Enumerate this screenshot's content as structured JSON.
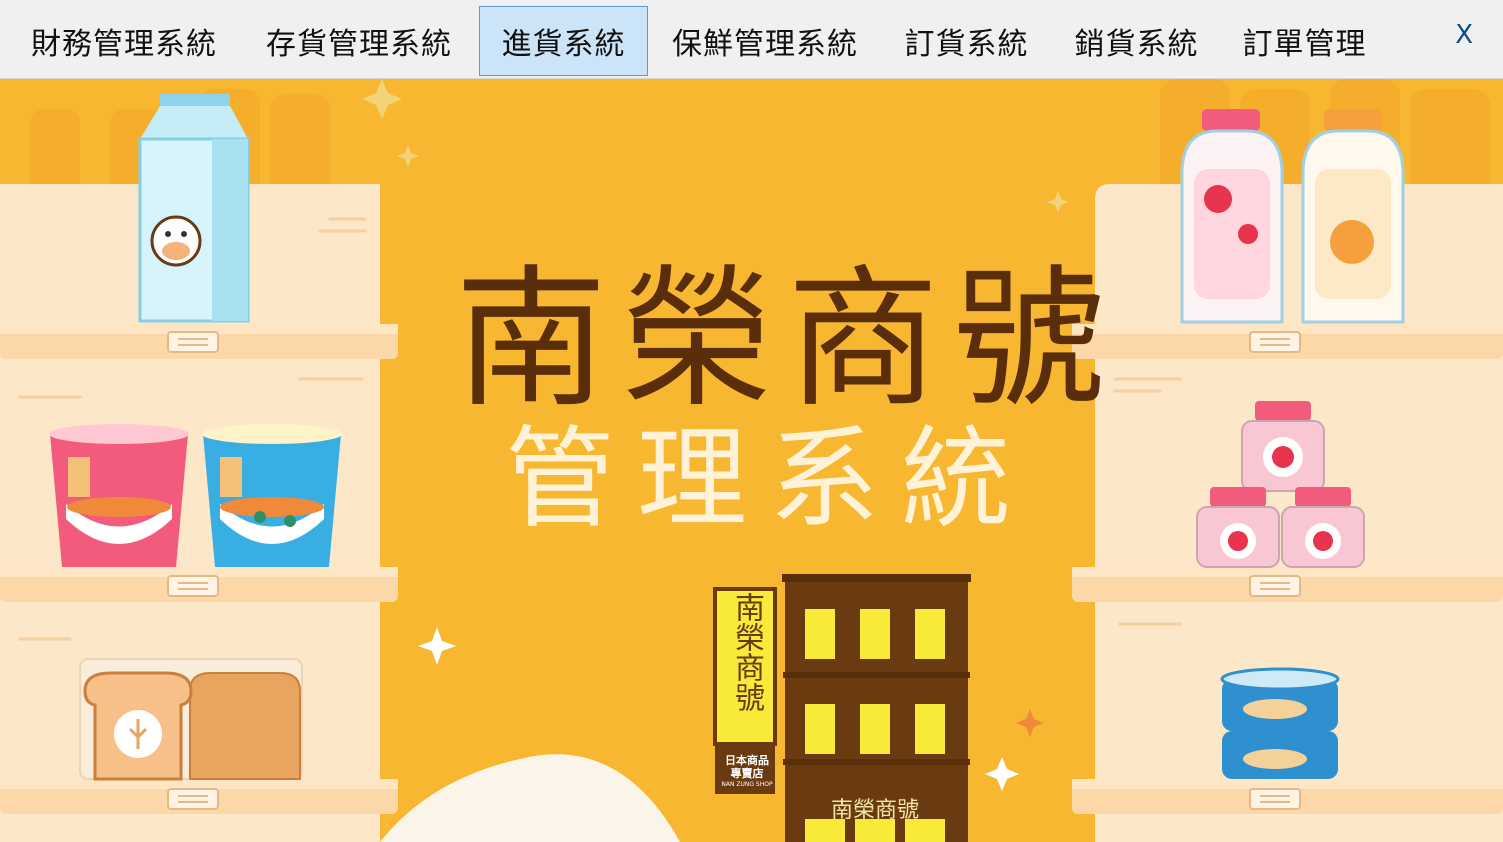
{
  "menu": {
    "tabs": [
      {
        "label": "財務管理系統",
        "active": false
      },
      {
        "label": "存貨管理系統",
        "active": false
      },
      {
        "label": "進貨系統",
        "active": true
      },
      {
        "label": "保鮮管理系統",
        "active": false
      },
      {
        "label": "訂貨系統",
        "active": false
      },
      {
        "label": "銷貨系統",
        "active": false
      },
      {
        "label": "訂單管理",
        "active": false
      }
    ],
    "close_label": "X"
  },
  "banner": {
    "title": "南榮商號",
    "subtitle": "管理系統",
    "shop_sign": "南榮商號",
    "shop_sign_sub_line1": "日本商品",
    "shop_sign_sub_line2": "專賣店",
    "shop_sign_sub_line3": "NAN ZUNG SHOP",
    "building_sign": "南榮商號"
  },
  "colors": {
    "background": "#f7b730",
    "title": "#5b2e0b",
    "subtitle": "#fff2d6",
    "shelf": "#fbe6c6",
    "active_tab": "#cce4f7"
  }
}
